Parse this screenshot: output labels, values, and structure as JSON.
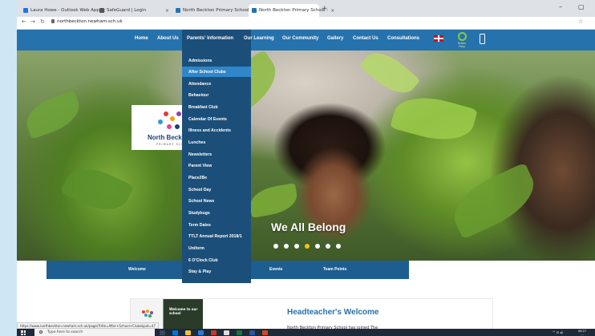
{
  "browser": {
    "tabs": [
      {
        "label": "Laura Howe - Outlook Web App",
        "favicon_color": "#1a73e8"
      },
      {
        "label": "SafeGuard | Login",
        "favicon_color": "#555555"
      },
      {
        "label": "North Beckton Primary School - ",
        "favicon_color": "#2672ad"
      },
      {
        "label": "North Beckton Primary School - ",
        "favicon_color": "#2672ad"
      }
    ],
    "new_tab": "+",
    "url": "northbeckton.newham.sch.uk",
    "close_glyph": "×"
  },
  "site_nav": {
    "items": [
      "Home",
      "About Us",
      "Parents' Information",
      "Our Learning",
      "Our Community",
      "Gallery",
      "Contact Us",
      "Consultations"
    ],
    "open_item_index": 2,
    "green_label": "Green Flag",
    "accent_color": "#2672ad",
    "menu_color": "#1b4f7a"
  },
  "dropdown": {
    "items": [
      "Admissions",
      "After School Clubs",
      "Attendance",
      "Behaviour",
      "Breakfast Club",
      "Calendar Of Events",
      "Illness and Accidents",
      "Lunches",
      "Newsletters",
      "Parent View",
      "Place2Be",
      "School Day",
      "School News",
      "Studybugs",
      "Term Dates",
      "TTLT Annual Report 2018/1",
      "Uniform",
      "6 O'Clock Club",
      "Stay & Play"
    ],
    "hovered_index": 1,
    "hover_color": "#2f86c8"
  },
  "hero": {
    "logo_name": "North Beckton",
    "logo_sub": "PRIMARY SCHOOL",
    "tagline": "We All Belong",
    "slide_count": 7,
    "active_slide_index": 3
  },
  "sub_tabs": [
    "Welcome",
    "Events",
    "Team Points"
  ],
  "welcome": {
    "thumb_text": "Welcome to our school",
    "title": "Headteacher's Welcome",
    "first_line": "North Beckton Primary School has joined The"
  },
  "status_url": "https://www.northbeckton.newham.sch.uk/page/?title=After+School+Clubs&pid=47",
  "taskbar": {
    "search_placeholder": "Type here to search",
    "clock_time": "08:27",
    "clock_date": "..."
  }
}
